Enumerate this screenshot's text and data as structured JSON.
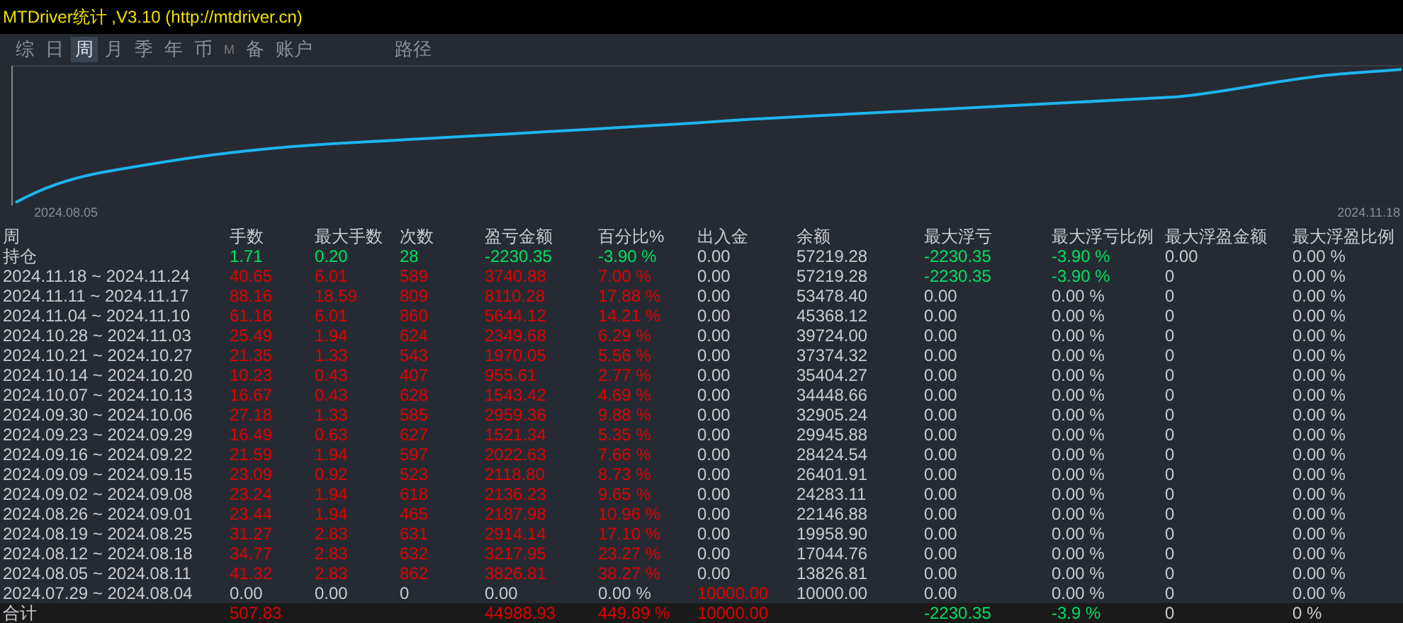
{
  "window": {
    "title": "MTDriver统计 ,V3.10 (http://mtdriver.cn)"
  },
  "tabs": [
    {
      "label": "综",
      "selected": false
    },
    {
      "label": "日",
      "selected": false
    },
    {
      "label": "周",
      "selected": true
    },
    {
      "label": "月",
      "selected": false
    },
    {
      "label": "季",
      "selected": false
    },
    {
      "label": "年",
      "selected": false
    },
    {
      "label": "币",
      "selected": false
    },
    {
      "label": "M",
      "selected": false,
      "kind": "small"
    },
    {
      "label": "备",
      "selected": false
    },
    {
      "label": "账户",
      "selected": false
    },
    {
      "label": "路径",
      "selected": false,
      "kind": "far"
    }
  ],
  "chart": {
    "start_label": "2024.08.05",
    "end_label": "2024.11.18"
  },
  "table": {
    "columns": [
      "周",
      "手数",
      "最大手数",
      "次数",
      "盈亏金额",
      "百分比%",
      "出入金",
      "余额",
      "最大浮亏",
      "最大浮亏比例",
      "最大浮盈金额",
      "最大浮盈比例"
    ],
    "rows": [
      {
        "kind": "normal",
        "cells": [
          {
            "v": "持仓"
          },
          {
            "v": "1.71",
            "color": "#00e060"
          },
          {
            "v": "0.20",
            "color": "#00e060"
          },
          {
            "v": "28",
            "color": "#00e060"
          },
          {
            "v": "-2230.35",
            "color": "#00e060"
          },
          {
            "v": "-3.90 %",
            "color": "#00e060"
          },
          {
            "v": "0.00"
          },
          {
            "v": "57219.28"
          },
          {
            "v": "-2230.35",
            "color": "#00e060"
          },
          {
            "v": "-3.90 %",
            "color": "#00e060"
          },
          {
            "v": "0.00"
          },
          {
            "v": "0.00 %"
          }
        ]
      },
      {
        "kind": "normal",
        "cells": [
          {
            "v": "2024.11.18 ~ 2024.11.24"
          },
          {
            "v": "40.65",
            "color": "#e00000"
          },
          {
            "v": "6.01",
            "color": "#e00000"
          },
          {
            "v": "589",
            "color": "#e00000"
          },
          {
            "v": "3740.88",
            "color": "#e00000"
          },
          {
            "v": "7.00 %",
            "color": "#e00000"
          },
          {
            "v": "0.00"
          },
          {
            "v": "57219.28"
          },
          {
            "v": "-2230.35",
            "color": "#00e060"
          },
          {
            "v": "-3.90 %",
            "color": "#00e060"
          },
          {
            "v": "0"
          },
          {
            "v": "0.00 %"
          }
        ]
      },
      {
        "kind": "normal",
        "cells": [
          {
            "v": "2024.11.11 ~ 2024.11.17"
          },
          {
            "v": "88.16",
            "color": "#e00000"
          },
          {
            "v": "18.59",
            "color": "#e00000"
          },
          {
            "v": "809",
            "color": "#e00000"
          },
          {
            "v": "8110.28",
            "color": "#e00000"
          },
          {
            "v": "17.88 %",
            "color": "#e00000"
          },
          {
            "v": "0.00"
          },
          {
            "v": "53478.40"
          },
          {
            "v": "0.00"
          },
          {
            "v": "0.00 %"
          },
          {
            "v": "0"
          },
          {
            "v": "0.00 %"
          }
        ]
      },
      {
        "kind": "normal",
        "cells": [
          {
            "v": "2024.11.04 ~ 2024.11.10"
          },
          {
            "v": "61.18",
            "color": "#e00000"
          },
          {
            "v": "6.01",
            "color": "#e00000"
          },
          {
            "v": "860",
            "color": "#e00000"
          },
          {
            "v": "5644.12",
            "color": "#e00000"
          },
          {
            "v": "14.21 %",
            "color": "#e00000"
          },
          {
            "v": "0.00"
          },
          {
            "v": "45368.12"
          },
          {
            "v": "0.00"
          },
          {
            "v": "0.00 %"
          },
          {
            "v": "0"
          },
          {
            "v": "0.00 %"
          }
        ]
      },
      {
        "kind": "normal",
        "cells": [
          {
            "v": "2024.10.28 ~ 2024.11.03"
          },
          {
            "v": "25.49",
            "color": "#e00000"
          },
          {
            "v": "1.94",
            "color": "#e00000"
          },
          {
            "v": "624",
            "color": "#e00000"
          },
          {
            "v": "2349.68",
            "color": "#e00000"
          },
          {
            "v": "6.29 %",
            "color": "#e00000"
          },
          {
            "v": "0.00"
          },
          {
            "v": "39724.00"
          },
          {
            "v": "0.00"
          },
          {
            "v": "0.00 %"
          },
          {
            "v": "0"
          },
          {
            "v": "0.00 %"
          }
        ]
      },
      {
        "kind": "normal",
        "cells": [
          {
            "v": "2024.10.21 ~ 2024.10.27"
          },
          {
            "v": "21.35",
            "color": "#e00000"
          },
          {
            "v": "1.33",
            "color": "#e00000"
          },
          {
            "v": "543",
            "color": "#e00000"
          },
          {
            "v": "1970.05",
            "color": "#e00000"
          },
          {
            "v": "5.56 %",
            "color": "#e00000"
          },
          {
            "v": "0.00"
          },
          {
            "v": "37374.32"
          },
          {
            "v": "0.00"
          },
          {
            "v": "0.00 %"
          },
          {
            "v": "0"
          },
          {
            "v": "0.00 %"
          }
        ]
      },
      {
        "kind": "normal",
        "cells": [
          {
            "v": "2024.10.14 ~ 2024.10.20"
          },
          {
            "v": "10.23",
            "color": "#e00000"
          },
          {
            "v": "0.43",
            "color": "#e00000"
          },
          {
            "v": "407",
            "color": "#e00000"
          },
          {
            "v": "955.61",
            "color": "#e00000"
          },
          {
            "v": "2.77 %",
            "color": "#e00000"
          },
          {
            "v": "0.00"
          },
          {
            "v": "35404.27"
          },
          {
            "v": "0.00"
          },
          {
            "v": "0.00 %"
          },
          {
            "v": "0"
          },
          {
            "v": "0.00 %"
          }
        ]
      },
      {
        "kind": "normal",
        "cells": [
          {
            "v": "2024.10.07 ~ 2024.10.13"
          },
          {
            "v": "16.67",
            "color": "#e00000"
          },
          {
            "v": "0.43",
            "color": "#e00000"
          },
          {
            "v": "628",
            "color": "#e00000"
          },
          {
            "v": "1543.42",
            "color": "#e00000"
          },
          {
            "v": "4.69 %",
            "color": "#e00000"
          },
          {
            "v": "0.00"
          },
          {
            "v": "34448.66"
          },
          {
            "v": "0.00"
          },
          {
            "v": "0.00 %"
          },
          {
            "v": "0"
          },
          {
            "v": "0.00 %"
          }
        ]
      },
      {
        "kind": "normal",
        "cells": [
          {
            "v": "2024.09.30 ~ 2024.10.06"
          },
          {
            "v": "27.18",
            "color": "#e00000"
          },
          {
            "v": "1.33",
            "color": "#e00000"
          },
          {
            "v": "585",
            "color": "#e00000"
          },
          {
            "v": "2959.36",
            "color": "#e00000"
          },
          {
            "v": "9.88 %",
            "color": "#e00000"
          },
          {
            "v": "0.00"
          },
          {
            "v": "32905.24"
          },
          {
            "v": "0.00"
          },
          {
            "v": "0.00 %"
          },
          {
            "v": "0"
          },
          {
            "v": "0.00 %"
          }
        ]
      },
      {
        "kind": "normal",
        "cells": [
          {
            "v": "2024.09.23 ~ 2024.09.29"
          },
          {
            "v": "16.49",
            "color": "#e00000"
          },
          {
            "v": "0.63",
            "color": "#e00000"
          },
          {
            "v": "627",
            "color": "#e00000"
          },
          {
            "v": "1521.34",
            "color": "#e00000"
          },
          {
            "v": "5.35 %",
            "color": "#e00000"
          },
          {
            "v": "0.00"
          },
          {
            "v": "29945.88"
          },
          {
            "v": "0.00"
          },
          {
            "v": "0.00 %"
          },
          {
            "v": "0"
          },
          {
            "v": "0.00 %"
          }
        ]
      },
      {
        "kind": "normal",
        "cells": [
          {
            "v": "2024.09.16 ~ 2024.09.22"
          },
          {
            "v": "21.59",
            "color": "#e00000"
          },
          {
            "v": "1.94",
            "color": "#e00000"
          },
          {
            "v": "597",
            "color": "#e00000"
          },
          {
            "v": "2022.63",
            "color": "#e00000"
          },
          {
            "v": "7.66 %",
            "color": "#e00000"
          },
          {
            "v": "0.00"
          },
          {
            "v": "28424.54"
          },
          {
            "v": "0.00"
          },
          {
            "v": "0.00 %"
          },
          {
            "v": "0"
          },
          {
            "v": "0.00 %"
          }
        ]
      },
      {
        "kind": "normal",
        "cells": [
          {
            "v": "2024.09.09 ~ 2024.09.15"
          },
          {
            "v": "23.09",
            "color": "#e00000"
          },
          {
            "v": "0.92",
            "color": "#e00000"
          },
          {
            "v": "523",
            "color": "#e00000"
          },
          {
            "v": "2118.80",
            "color": "#e00000"
          },
          {
            "v": "8.73 %",
            "color": "#e00000"
          },
          {
            "v": "0.00"
          },
          {
            "v": "26401.91"
          },
          {
            "v": "0.00"
          },
          {
            "v": "0.00 %"
          },
          {
            "v": "0"
          },
          {
            "v": "0.00 %"
          }
        ]
      },
      {
        "kind": "normal",
        "cells": [
          {
            "v": "2024.09.02 ~ 2024.09.08"
          },
          {
            "v": "23.24",
            "color": "#e00000"
          },
          {
            "v": "1.94",
            "color": "#e00000"
          },
          {
            "v": "618",
            "color": "#e00000"
          },
          {
            "v": "2136.23",
            "color": "#e00000"
          },
          {
            "v": "9.65 %",
            "color": "#e00000"
          },
          {
            "v": "0.00"
          },
          {
            "v": "24283.11"
          },
          {
            "v": "0.00"
          },
          {
            "v": "0.00 %"
          },
          {
            "v": "0"
          },
          {
            "v": "0.00 %"
          }
        ]
      },
      {
        "kind": "normal",
        "cells": [
          {
            "v": "2024.08.26 ~ 2024.09.01"
          },
          {
            "v": "23.44",
            "color": "#e00000"
          },
          {
            "v": "1.94",
            "color": "#e00000"
          },
          {
            "v": "465",
            "color": "#e00000"
          },
          {
            "v": "2187.98",
            "color": "#e00000"
          },
          {
            "v": "10.96 %",
            "color": "#e00000"
          },
          {
            "v": "0.00"
          },
          {
            "v": "22146.88"
          },
          {
            "v": "0.00"
          },
          {
            "v": "0.00 %"
          },
          {
            "v": "0"
          },
          {
            "v": "0.00 %"
          }
        ]
      },
      {
        "kind": "normal",
        "cells": [
          {
            "v": "2024.08.19 ~ 2024.08.25"
          },
          {
            "v": "31.27",
            "color": "#e00000"
          },
          {
            "v": "2.83",
            "color": "#e00000"
          },
          {
            "v": "631",
            "color": "#e00000"
          },
          {
            "v": "2914.14",
            "color": "#e00000"
          },
          {
            "v": "17.10 %",
            "color": "#e00000"
          },
          {
            "v": "0.00"
          },
          {
            "v": "19958.90"
          },
          {
            "v": "0.00"
          },
          {
            "v": "0.00 %"
          },
          {
            "v": "0"
          },
          {
            "v": "0.00 %"
          }
        ]
      },
      {
        "kind": "normal",
        "cells": [
          {
            "v": "2024.08.12 ~ 2024.08.18"
          },
          {
            "v": "34.77",
            "color": "#e00000"
          },
          {
            "v": "2.83",
            "color": "#e00000"
          },
          {
            "v": "632",
            "color": "#e00000"
          },
          {
            "v": "3217.95",
            "color": "#e00000"
          },
          {
            "v": "23.27 %",
            "color": "#e00000"
          },
          {
            "v": "0.00"
          },
          {
            "v": "17044.76"
          },
          {
            "v": "0.00"
          },
          {
            "v": "0.00 %"
          },
          {
            "v": "0"
          },
          {
            "v": "0.00 %"
          }
        ]
      },
      {
        "kind": "normal",
        "cells": [
          {
            "v": "2024.08.05 ~ 2024.08.11"
          },
          {
            "v": "41.32",
            "color": "#e00000"
          },
          {
            "v": "2.83",
            "color": "#e00000"
          },
          {
            "v": "862",
            "color": "#e00000"
          },
          {
            "v": "3826.81",
            "color": "#e00000"
          },
          {
            "v": "38.27 %",
            "color": "#e00000"
          },
          {
            "v": "0.00"
          },
          {
            "v": "13826.81"
          },
          {
            "v": "0.00"
          },
          {
            "v": "0.00 %"
          },
          {
            "v": "0"
          },
          {
            "v": "0.00 %"
          }
        ]
      },
      {
        "kind": "normal",
        "cells": [
          {
            "v": "2024.07.29 ~ 2024.08.04"
          },
          {
            "v": "0.00"
          },
          {
            "v": "0.00"
          },
          {
            "v": "0"
          },
          {
            "v": "0.00"
          },
          {
            "v": "0.00 %"
          },
          {
            "v": "10000.00",
            "color": "#e00000"
          },
          {
            "v": "10000.00"
          },
          {
            "v": "0.00"
          },
          {
            "v": "0.00 %"
          },
          {
            "v": "0"
          },
          {
            "v": "0.00 %"
          }
        ]
      },
      {
        "kind": "total",
        "cells": [
          {
            "v": "合计"
          },
          {
            "v": "507.83",
            "color": "#e00000"
          },
          {},
          {},
          {
            "v": "44988.93",
            "color": "#e00000"
          },
          {
            "v": "449.89 %",
            "color": "#e00000"
          },
          {
            "v": "10000.00",
            "color": "#e00000"
          },
          {},
          {
            "v": "-2230.35",
            "color": "#00e060"
          },
          {
            "v": "-3.9 %",
            "color": "#00e060"
          },
          {
            "v": "0"
          },
          {
            "v": "0 %"
          }
        ]
      }
    ]
  }
}
